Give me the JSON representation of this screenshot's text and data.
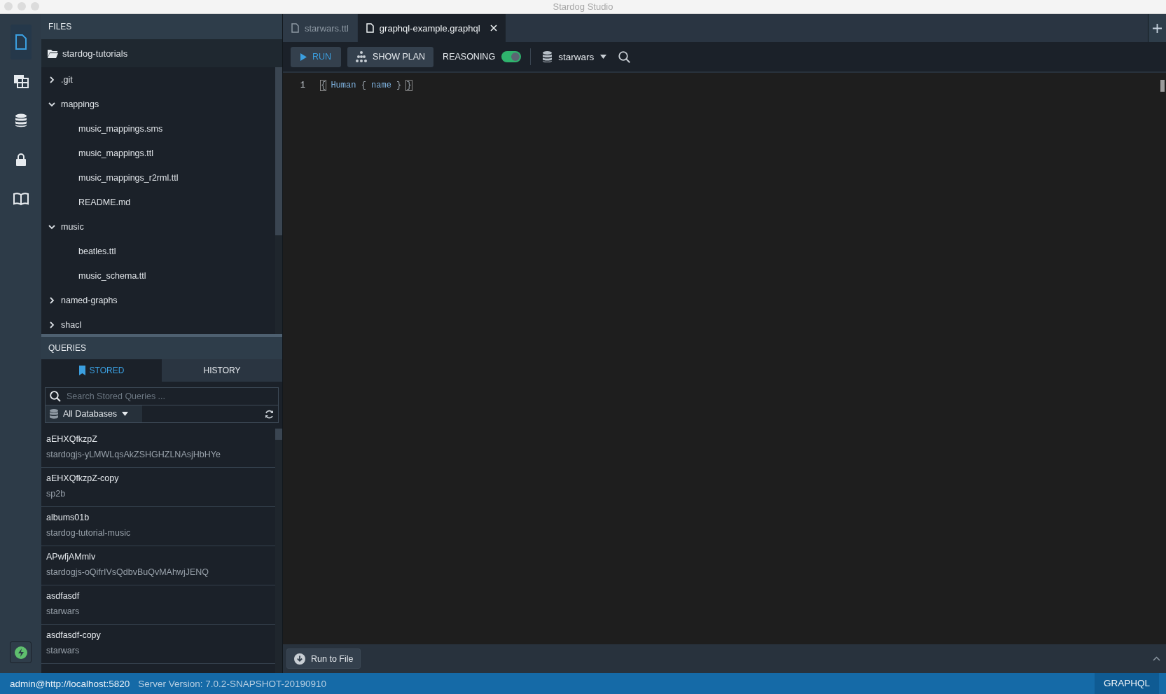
{
  "window": {
    "title": "Stardog Studio"
  },
  "rail": {
    "items": [
      {
        "kind": "file",
        "selected": true
      },
      {
        "kind": "table",
        "selected": false
      },
      {
        "kind": "database",
        "selected": false
      },
      {
        "kind": "lock",
        "selected": false
      },
      {
        "kind": "book",
        "selected": false
      }
    ],
    "bottom": {
      "kind": "bolt"
    }
  },
  "files": {
    "title": "FILES",
    "root": "stardog-tutorials",
    "tree": [
      {
        "label": ".git",
        "expanded": false
      },
      {
        "label": "mappings",
        "expanded": true,
        "children": [
          {
            "label": "music_mappings.sms"
          },
          {
            "label": "music_mappings.ttl"
          },
          {
            "label": "music_mappings_r2rml.ttl"
          },
          {
            "label": "README.md"
          }
        ]
      },
      {
        "label": "music",
        "expanded": true,
        "children": [
          {
            "label": "beatles.ttl"
          },
          {
            "label": "music_schema.ttl"
          }
        ]
      },
      {
        "label": "named-graphs",
        "expanded": false
      },
      {
        "label": "shacl",
        "expanded": false
      }
    ]
  },
  "queries": {
    "title": "QUERIES",
    "tabs": [
      {
        "label": "STORED",
        "selected": true
      },
      {
        "label": "HISTORY",
        "selected": false
      }
    ],
    "search": {
      "placeholder": "Search Stored Queries ..."
    },
    "database_filter": "All Databases",
    "items": [
      {
        "name": "aEHXQfkzpZ",
        "database": "stardogjs-yLMWLqsAkZSHGHZLNAsjHbHYe"
      },
      {
        "name": "aEHXQfkzpZ-copy",
        "database": "sp2b"
      },
      {
        "name": "albums01b",
        "database": "stardog-tutorial-music"
      },
      {
        "name": "APwfjAMmlv",
        "database": "stardogjs-oQifrIVsQdbvBuQvMAhwjJENQ"
      },
      {
        "name": "asdfasdf",
        "database": "starwars"
      },
      {
        "name": "asdfasdf-copy",
        "database": "starwars"
      }
    ]
  },
  "editor": {
    "tabs": [
      {
        "label": "starwars.ttl",
        "selected": false
      },
      {
        "label": "graphql-example.graphql",
        "selected": true
      }
    ],
    "toolbar": {
      "run": "RUN",
      "show_plan": "SHOW PLAN",
      "reasoning": {
        "label": "REASONING",
        "on": true
      },
      "database": "starwars"
    },
    "lines": [
      {
        "number": "1",
        "tokens": [
          {
            "text": "{",
            "kind": "matched_brace"
          },
          {
            "text": " Human ",
            "kind": "identifier"
          },
          {
            "text": "{",
            "kind": "brace"
          },
          {
            "text": " name ",
            "kind": "identifier"
          },
          {
            "text": "} ",
            "kind": "brace"
          },
          {
            "text": "}",
            "kind": "matched_brace"
          }
        ]
      }
    ]
  },
  "bottom_bar": {
    "run_to_file": "Run to File"
  },
  "status_bar": {
    "connection": "admin@http://localhost:5820",
    "server_version": "Server Version: 7.0.2-SNAPSHOT-20190910",
    "mode": "GRAPHQL"
  }
}
